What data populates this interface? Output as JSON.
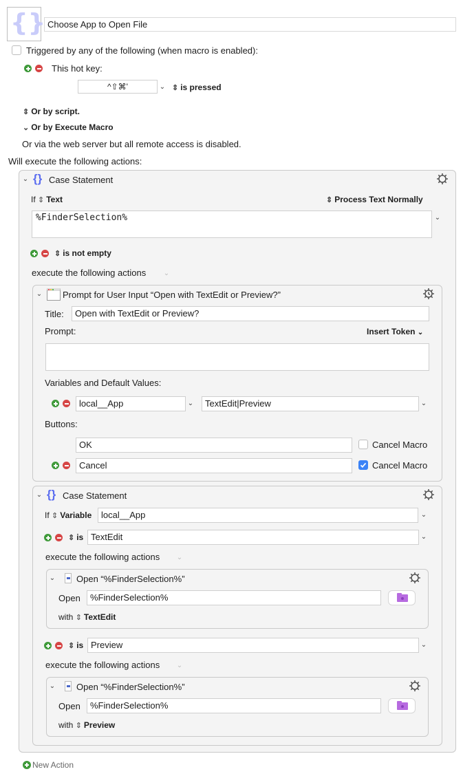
{
  "macro": {
    "icon": "case-statement-braces-icon",
    "name": "Choose App to Open File"
  },
  "triggers": {
    "checkbox_label": "Triggered by any of the following (when macro is enabled):",
    "checkbox_checked": false,
    "hotkey_label": "This hot key:",
    "hotkey_value": "^⇧⌘'",
    "hotkey_condition": "is pressed",
    "or_script": "Or by script.",
    "or_execute_macro": "Or by Execute Macro",
    "web_server_note": "Or via the web server but all remote access is disabled."
  },
  "actions_heading": "Will execute the following actions:",
  "case1": {
    "title": "Case Statement",
    "if_label": "If",
    "if_type": "Text",
    "process_option": "Process Text Normally",
    "text_value": "%FinderSelection%",
    "condition": "is not empty",
    "execute_label": "execute the following actions",
    "prompt": {
      "title": "Prompt for User Input “Open with TextEdit or Preview?”",
      "title_label": "Title:",
      "title_value": "Open with TextEdit or Preview?",
      "prompt_label": "Prompt:",
      "insert_token": "Insert Token",
      "prompt_value": "",
      "variables_label": "Variables and Default Values:",
      "variable_name": "local__App",
      "variable_default": "TextEdit|Preview",
      "buttons_label": "Buttons:",
      "buttons": [
        {
          "label": "OK",
          "cancel_macro_label": "Cancel Macro",
          "cancel_macro": false
        },
        {
          "label": "Cancel",
          "cancel_macro_label": "Cancel Macro",
          "cancel_macro": true
        }
      ]
    }
  },
  "case2": {
    "title": "Case Statement",
    "if_label": "If",
    "if_type": "Variable",
    "variable_value": "local__App",
    "cases": [
      {
        "op": "is",
        "value": "TextEdit",
        "execute_label": "execute the following actions",
        "action_title": "Open “%FinderSelection%”",
        "open_label": "Open",
        "open_value": "%FinderSelection%",
        "with_label": "with",
        "with_app": "TextEdit"
      },
      {
        "op": "is",
        "value": "Preview",
        "execute_label": "execute the following actions",
        "action_title": "Open “%FinderSelection%”",
        "open_label": "Open",
        "open_value": "%FinderSelection%",
        "with_label": "with",
        "with_app": "Preview"
      }
    ]
  },
  "new_action": "New Action",
  "colors": {
    "accent_blue": "#3b82f6",
    "add_green": "#3f9a3a",
    "remove_red": "#d64545",
    "braces_blue": "#5a6cf0",
    "folder_purple": "#b76be0"
  }
}
